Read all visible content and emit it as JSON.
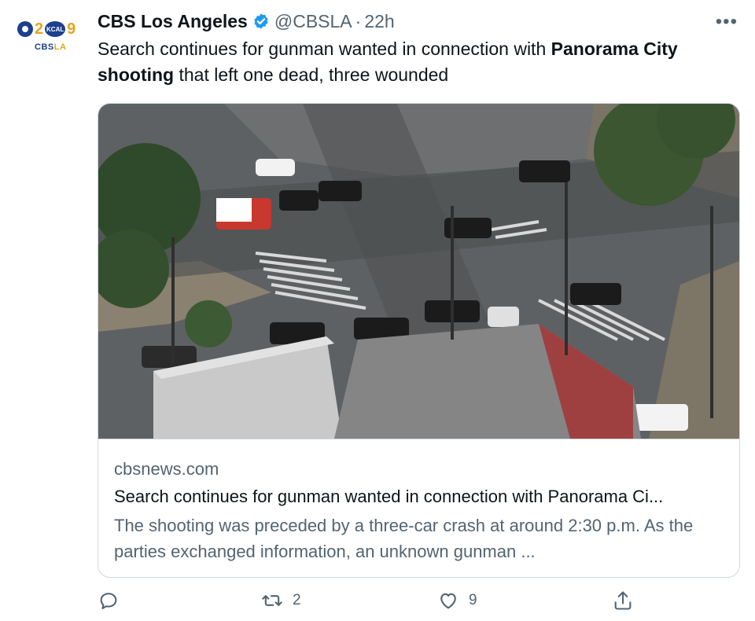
{
  "author": {
    "name": "CBS Los Angeles",
    "handle": "@CBSLA",
    "separator": "·",
    "time": "22h",
    "avatar_text": {
      "num_left": "2",
      "kcal": "KCAL",
      "num_right": "9",
      "label_cbs": "CBS",
      "label_la": "LA"
    }
  },
  "more_label": "•••",
  "tweet": {
    "text_1": "Search continues for gunman wanted in connection with ",
    "bold": "Panorama City shooting",
    "text_2": " that left one dead, three wounded"
  },
  "card": {
    "image_desc": "aerial-intersection-police-scene",
    "domain": "cbsnews.com",
    "title": "Search continues for gunman wanted in connection with Panorama Ci...",
    "description": "The shooting was preceded by a three-car crash at around 2:30 p.m. As the parties exchanged information, an unknown gunman ..."
  },
  "actions": {
    "retweets": "2",
    "likes": "9"
  },
  "colors": {
    "text": "#0f1419",
    "secondary": "#536471",
    "verified": "#1d9bf0",
    "border": "#cfd9de"
  }
}
